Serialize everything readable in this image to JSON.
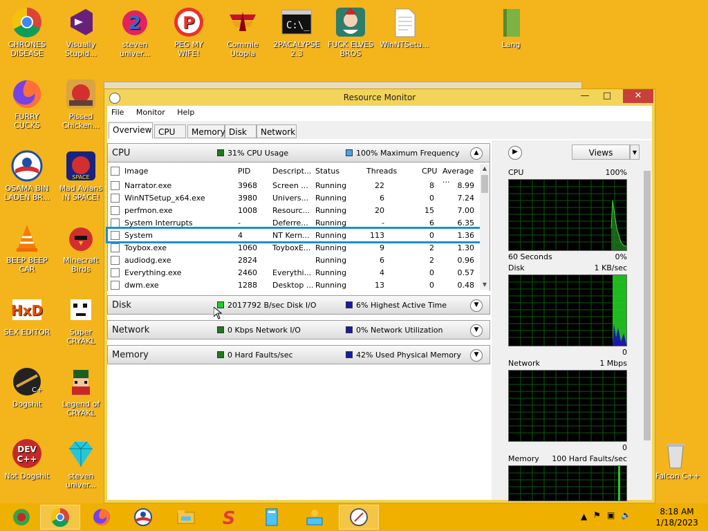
{
  "desktop": {
    "icons": [
      {
        "label": "CHRONES DISEASE",
        "icon": "chrome-icon"
      },
      {
        "label": "Visually Stupid...",
        "icon": "visual-studio-icon"
      },
      {
        "label": "steven univer...",
        "icon": "steven-universe-icon"
      },
      {
        "label": "PEG MY WIFE!",
        "icon": "peggle-icon"
      },
      {
        "label": "Commie Utopia",
        "icon": "commie-utopia-icon"
      },
      {
        "label": "2PACALYPSE 2.3",
        "icon": "cmd-icon"
      },
      {
        "label": "FUCK ELVES BROS",
        "icon": "elf-game-icon"
      },
      {
        "label": "WinNTSetu...",
        "icon": "document-icon"
      },
      {
        "label": "Lang",
        "icon": "green-book-icon"
      },
      {
        "label": "FURRY CUCKS",
        "icon": "firefox-icon"
      },
      {
        "label": "Pissed Chicken...",
        "icon": "angry-birds-seasons-icon"
      },
      {
        "label": "OSAMA BIN LADEN BR...",
        "icon": "obama-logo-icon"
      },
      {
        "label": "Mad Avians IN SPACE!",
        "icon": "angry-birds-space-icon"
      },
      {
        "label": "BEEP BEEP CAR",
        "icon": "vlc-icon"
      },
      {
        "label": "Minecraft Birds",
        "icon": "angry-birds-icon"
      },
      {
        "label": "SEX EDITOR",
        "icon": "hxd-icon"
      },
      {
        "label": "Super CRYAKL",
        "icon": "pixel-dog-icon"
      },
      {
        "label": "Dogshit",
        "icon": "dogshit-icon"
      },
      {
        "label": "Legend of CRYAKL",
        "icon": "pixel-character-icon"
      },
      {
        "label": "Not Dogshit",
        "icon": "devcpp-icon"
      },
      {
        "label": "steven univer...",
        "icon": "diamond-icon"
      },
      {
        "label": "Recycle Bin",
        "icon": "recycle-bin-icon"
      },
      {
        "label": "Falcon C++",
        "icon": "falcon-icon"
      }
    ]
  },
  "window": {
    "title": "Resource Monitor",
    "menu": [
      "File",
      "Monitor",
      "Help"
    ],
    "tabs": [
      "Overview",
      "CPU",
      "Memory",
      "Disk",
      "Network"
    ],
    "active_tab": "Overview"
  },
  "cpu_section": {
    "name": "CPU",
    "legend1": "31% CPU Usage",
    "legend1_color": "#1e7a1e",
    "legend2": "100% Maximum Frequency",
    "legend2_color": "#4aa3e8",
    "columns": [
      "Image",
      "PID",
      "Descript...",
      "Status",
      "Threads",
      "CPU",
      "Average ..."
    ],
    "rows": [
      {
        "image": "Narrator.exe",
        "pid": "3968",
        "desc": "Screen ...",
        "status": "Running",
        "threads": "22",
        "cpu": "8",
        "avg": "8.99"
      },
      {
        "image": "WinNTSetup_x64.exe",
        "pid": "3980",
        "desc": "Univers...",
        "status": "Running",
        "threads": "6",
        "cpu": "0",
        "avg": "7.24"
      },
      {
        "image": "perfmon.exe",
        "pid": "1008",
        "desc": "Resourc...",
        "status": "Running",
        "threads": "20",
        "cpu": "15",
        "avg": "7.00"
      },
      {
        "image": "System Interrupts",
        "pid": "-",
        "desc": "Deferre...",
        "status": "Running",
        "threads": "-",
        "cpu": "6",
        "avg": "6.35"
      },
      {
        "image": "System",
        "pid": "4",
        "desc": "NT Kern...",
        "status": "Running",
        "threads": "113",
        "cpu": "0",
        "avg": "1.36"
      },
      {
        "image": "Toybox.exe",
        "pid": "1060",
        "desc": "ToyboxE...",
        "status": "Running",
        "threads": "9",
        "cpu": "2",
        "avg": "1.30"
      },
      {
        "image": "audiodg.exe",
        "pid": "2824",
        "desc": "",
        "status": "Running",
        "threads": "6",
        "cpu": "2",
        "avg": "0.96"
      },
      {
        "image": "Everything.exe",
        "pid": "2460",
        "desc": "Everythi...",
        "status": "Running",
        "threads": "4",
        "cpu": "0",
        "avg": "0.57"
      },
      {
        "image": "dwm.exe",
        "pid": "1288",
        "desc": "Desktop ...",
        "status": "Running",
        "threads": "13",
        "cpu": "0",
        "avg": "0.48"
      }
    ]
  },
  "disk_section": {
    "name": "Disk",
    "legend1": "2017792 B/sec Disk I/O",
    "legend1_color": "#22cc22",
    "legend2": "6% Highest Active Time",
    "legend2_color": "#1a1aa8"
  },
  "network_section": {
    "name": "Network",
    "legend1": "0 Kbps Network I/O",
    "legend1_color": "#1e7a1e",
    "legend2": "0% Network Utilization",
    "legend2_color": "#1a1aa8"
  },
  "memory_section": {
    "name": "Memory",
    "legend1": "0 Hard Faults/sec",
    "legend1_color": "#1e7a1e",
    "legend2": "42% Used Physical Memory",
    "legend2_color": "#1a1aa8"
  },
  "right_pane": {
    "views_label": "Views",
    "graphs": [
      {
        "label": "CPU",
        "max": "100%",
        "below_left": "60 Seconds",
        "below_right": "0%"
      },
      {
        "label": "Disk",
        "max": "1 KB/sec",
        "below_left": "",
        "below_right": "0"
      },
      {
        "label": "Network",
        "max": "1 Mbps",
        "below_left": "",
        "below_right": "0"
      },
      {
        "label": "Memory",
        "max": "100 Hard Faults/sec",
        "below_left": "",
        "below_right": ""
      }
    ]
  },
  "taskbar": {
    "buttons": [
      "start-icon",
      "chrome-icon",
      "firefox-icon",
      "obama-logo-icon",
      "file-explorer-icon",
      "s-icon",
      "winntsetup-icon",
      "network-user-icon",
      "resource-monitor-icon"
    ],
    "clock_time": "8:18 AM",
    "clock_date": "1/18/2023"
  }
}
